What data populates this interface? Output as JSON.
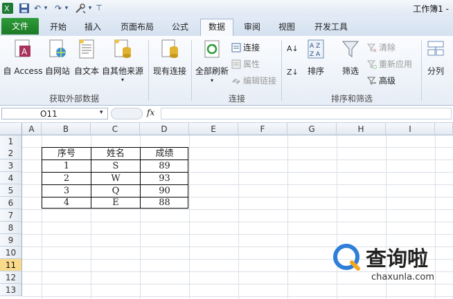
{
  "title_bar": {
    "title": "工作簿1 -",
    "undo_sym": "↶",
    "redo_sym": "↷",
    "dropdown_sym": "▾"
  },
  "tabs": [
    "文件",
    "开始",
    "插入",
    "页面布局",
    "公式",
    "数据",
    "审阅",
    "视图",
    "开发工具"
  ],
  "ribbon": {
    "get_external": {
      "access": "自 Access",
      "web": "自网站",
      "text": "自文本",
      "other": "自其他来源",
      "group": "获取外部数据"
    },
    "existing": "现有连接",
    "connections": {
      "refresh_all": "全部刷新",
      "connect": "连接",
      "properties": "属性",
      "edit_links": "编辑链接",
      "group": "连接"
    },
    "sort_filter": {
      "sort": "排序",
      "filter": "筛选",
      "clear": "清除",
      "reapply": "重新应用",
      "advanced": "高级",
      "group": "排序和筛选",
      "az": "A↓",
      "za": "Z↓"
    },
    "split": "分列"
  },
  "formula_bar": {
    "cell_ref": "O11",
    "fx": "fx",
    "formula": ""
  },
  "columns": [
    "A",
    "B",
    "C",
    "D",
    "E",
    "F",
    "G",
    "H",
    "I"
  ],
  "rows": [
    "1",
    "2",
    "3",
    "4",
    "5",
    "6",
    "7",
    "8",
    "9",
    "10",
    "11",
    "12",
    "13"
  ],
  "selected_row": "11",
  "table": {
    "headers": [
      "序号",
      "姓名",
      "成绩"
    ],
    "rows": [
      [
        "1",
        "S",
        "89"
      ],
      [
        "2",
        "W",
        "93"
      ],
      [
        "3",
        "Q",
        "90"
      ],
      [
        "4",
        "E",
        "88"
      ]
    ]
  },
  "watermark": {
    "brand": "查询啦",
    "url": "chaxunla.com"
  },
  "colors": {
    "file_tab": "#1c7a26",
    "selected_row": "#f9d98a",
    "accent": "#2f7ed8"
  }
}
